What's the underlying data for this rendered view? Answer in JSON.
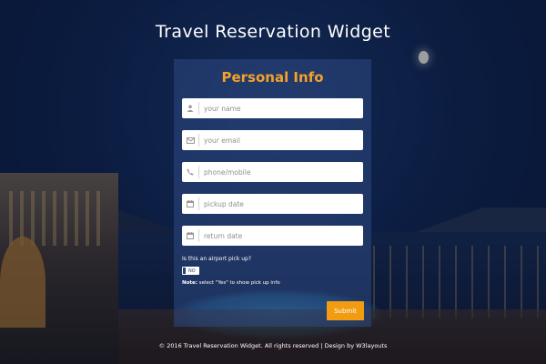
{
  "header": {
    "title": "Travel Reservation Widget"
  },
  "form": {
    "title": "Personal Info",
    "fields": [
      {
        "icon": "user-icon",
        "placeholder": "your name"
      },
      {
        "icon": "envelope-icon",
        "placeholder": "your email"
      },
      {
        "icon": "phone-icon",
        "placeholder": "phone/mobile"
      },
      {
        "icon": "calendar-icon",
        "placeholder": "pickup date"
      },
      {
        "icon": "calendar-icon",
        "placeholder": "return date"
      }
    ],
    "airport_question": "Is this an airport pick up?",
    "toggle_label": "NO",
    "note_prefix": "Note:",
    "note_text": " select \"Yes\" to show pick up info",
    "submit_label": "Submit"
  },
  "footer": {
    "text": "© 2016 Travel Reservation Widget. All rights reserved | Design by W3layouts"
  },
  "colors": {
    "accent": "#f39c12",
    "title": "#f3a12a",
    "toggle": "#2b3f73"
  }
}
